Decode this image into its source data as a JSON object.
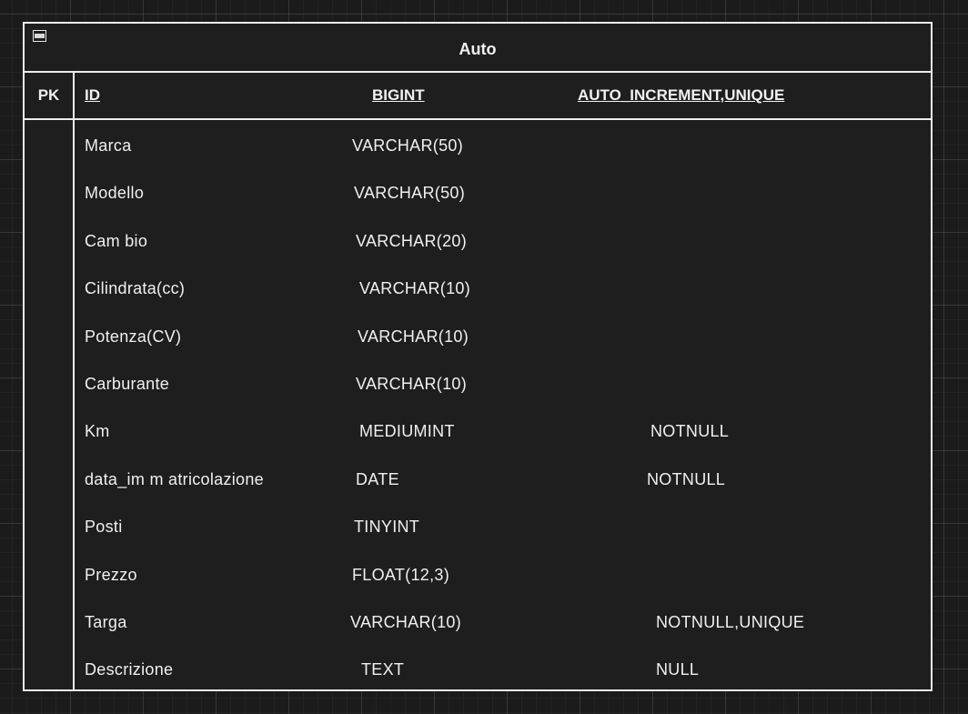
{
  "entity": {
    "title": "Auto",
    "primary_key": {
      "key_label": "PK",
      "name": "ID",
      "type": "BIGINT",
      "constraints": "AUTO_INCREMENT,UNIQUE"
    },
    "fields": [
      {
        "name": "Marca",
        "type": "VARCHAR(50)",
        "constraints": ""
      },
      {
        "name": "Modello",
        "type": "VARCHAR(50)",
        "constraints": ""
      },
      {
        "name": "Cam bio",
        "type": "VARCHAR(20)",
        "constraints": ""
      },
      {
        "name": "Cilindrata(cc)",
        "type": "VARCHAR(10)",
        "constraints": ""
      },
      {
        "name": "Potenza(CV)",
        "type": "VARCHAR(10)",
        "constraints": ""
      },
      {
        "name": "Carburante",
        "type": "VARCHAR(10)",
        "constraints": ""
      },
      {
        "name": "Km",
        "type": "MEDIUMINT",
        "constraints": "NOTNULL"
      },
      {
        "name": "data_im m atricolazione",
        "type": "DATE",
        "constraints": "NOTNULL"
      },
      {
        "name": "Posti",
        "type": "TINYINT",
        "constraints": ""
      },
      {
        "name": "Prezzo",
        "type": "FLOAT(12,3)",
        "constraints": ""
      },
      {
        "name": "Targa",
        "type": "VARCHAR(10)",
        "constraints": "NOTNULL,UNIQUE"
      },
      {
        "name": "Descrizione",
        "type": "TEXT",
        "constraints": "NULL"
      }
    ]
  },
  "colors": {
    "background": "#1b1b1b",
    "border": "#ececec",
    "text": "#f0f0f0"
  }
}
